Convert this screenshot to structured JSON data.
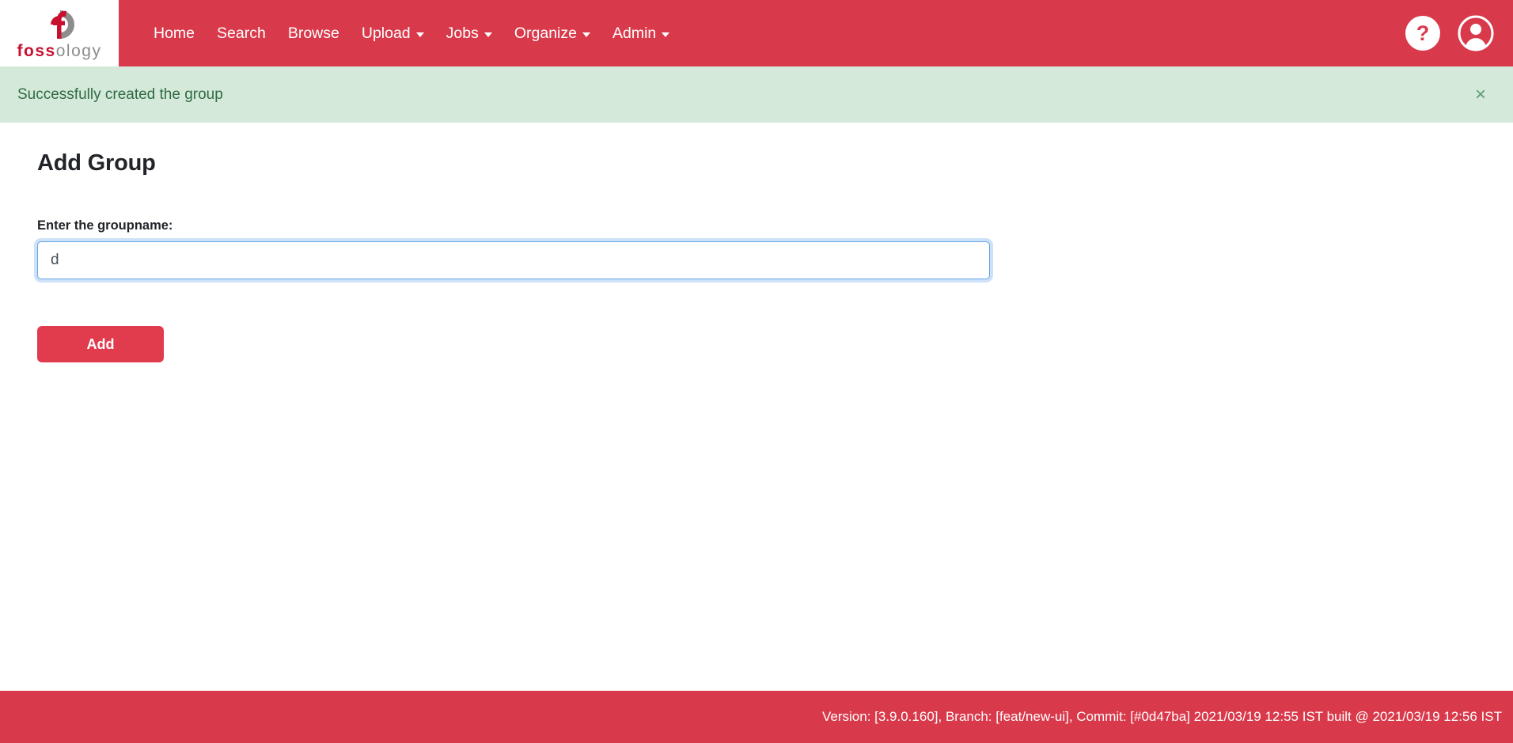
{
  "brand": {
    "wordmark_primary": "foss",
    "wordmark_secondary": "ology",
    "logo_icon": "fossology-logo-icon"
  },
  "nav": {
    "items": [
      {
        "label": "Home",
        "has_dropdown": false
      },
      {
        "label": "Search",
        "has_dropdown": false
      },
      {
        "label": "Browse",
        "has_dropdown": false
      },
      {
        "label": "Upload",
        "has_dropdown": true
      },
      {
        "label": "Jobs",
        "has_dropdown": true
      },
      {
        "label": "Organize",
        "has_dropdown": true
      },
      {
        "label": "Admin",
        "has_dropdown": true
      }
    ],
    "help_icon_label": "?",
    "help_icon": "question-mark-icon",
    "user_icon": "user-account-icon"
  },
  "alert": {
    "message": "Successfully created the group",
    "close_label": "×",
    "background_color": "#d4e9d9",
    "text_color": "#2f6b45"
  },
  "main": {
    "page_title": "Add Group",
    "field_label": "Enter the groupname:",
    "input_value": "d",
    "input_placeholder": "",
    "submit_label": "Add"
  },
  "footer": {
    "text": "Version: [3.9.0.160], Branch: [feat/new-ui], Commit: [#0d47ba] 2021/03/19 12:55 IST built @ 2021/03/19 12:56 IST"
  },
  "colors": {
    "brand_red": "#d93a4b",
    "button_red": "#e13b4e",
    "logo_red": "#c8102e",
    "logo_gray": "#8d8d8d",
    "focus_blue": "#64a6e8"
  }
}
